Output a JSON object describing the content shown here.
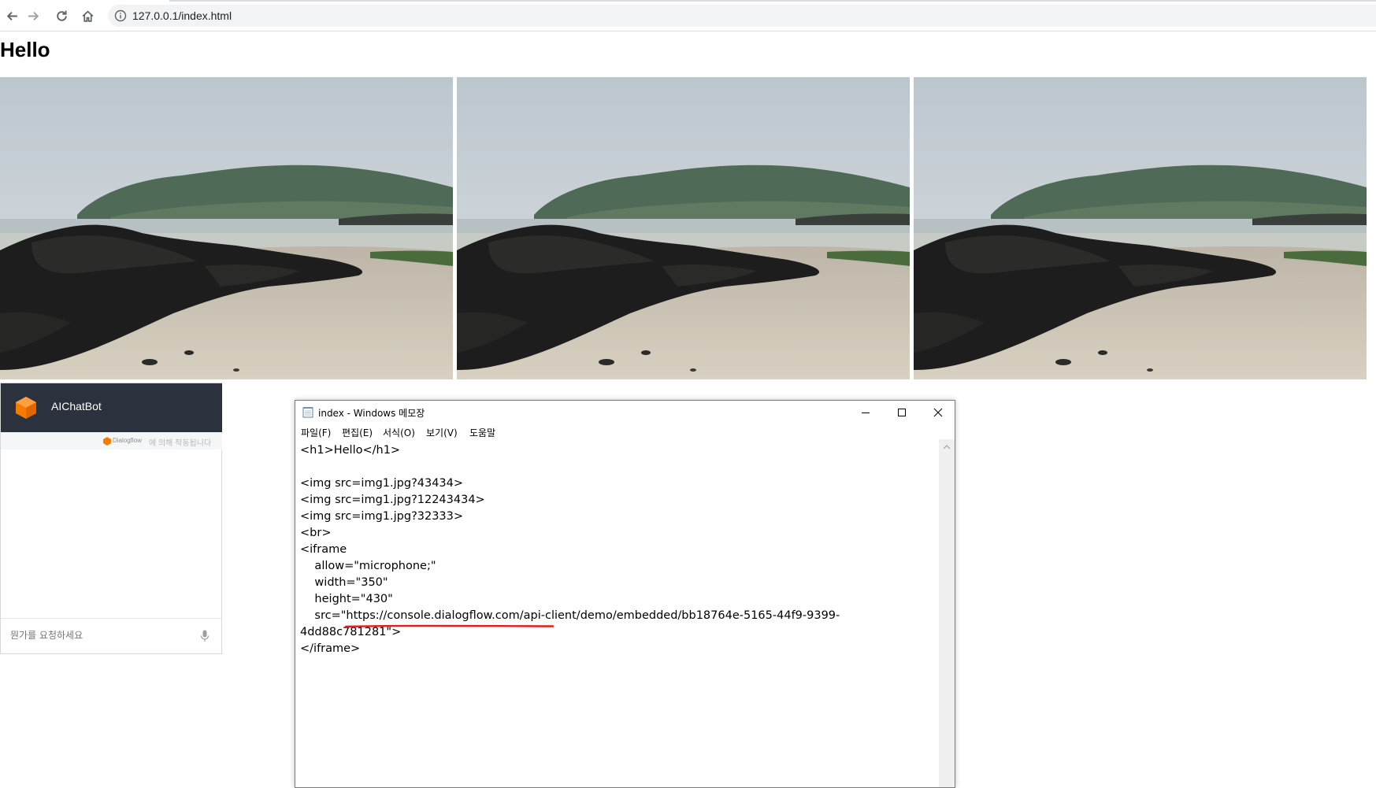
{
  "browser": {
    "url": "127.0.0.1/index.html",
    "icons": [
      "back-arrow-icon",
      "forward-arrow-icon",
      "reload-icon",
      "home-icon",
      "info-icon"
    ]
  },
  "page": {
    "heading": "Hello",
    "photos": [
      {
        "name": "beach-photo-1"
      },
      {
        "name": "beach-photo-2"
      },
      {
        "name": "beach-photo-3"
      }
    ]
  },
  "chatbot": {
    "title": "AIChatBot",
    "powered_brand": "Dialogflow",
    "powered_text": "에 의해 작동됩니다",
    "input_placeholder": "뭔가를 요청하세요",
    "colors": {
      "header": "#2c323d",
      "logo": "#f57c00"
    }
  },
  "notepad": {
    "title": "index - Windows 메모장",
    "menu": [
      "파일(F)",
      "편집(E)",
      "서식(O)",
      "보기(V)",
      "도움말"
    ],
    "lines": [
      "<h1>Hello</h1>",
      "",
      "<img src=img1.jpg?43434>",
      "<img src=img1.jpg?12243434>",
      "<img src=img1.jpg?32333>",
      "<br>",
      "<iframe",
      "    allow=\"microphone;\"",
      "    width=\"350\"",
      "    height=\"430\"",
      "    src=\"https://console.dialogflow.com/api-client/demo/embedded/bb18764e-5165-44f9-9399-",
      "4dd88c781281\">",
      "</iframe>"
    ],
    "highlight_color": "#e01e1e"
  }
}
